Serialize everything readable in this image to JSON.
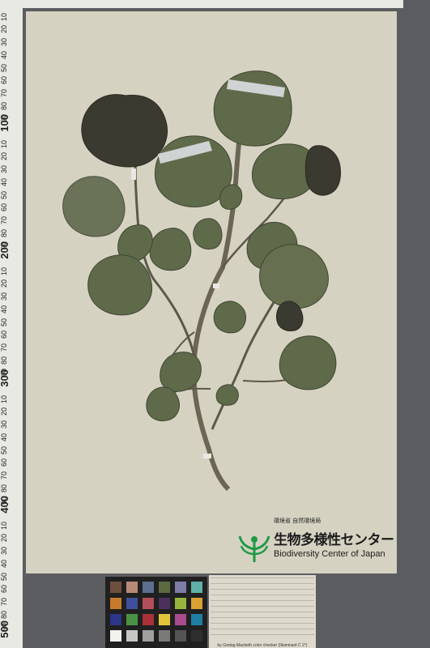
{
  "ruler": {
    "major_labels": [
      "100",
      "200",
      "300",
      "400",
      "500"
    ],
    "minor_labels": [
      "10",
      "20",
      "30",
      "40",
      "50",
      "60",
      "70",
      "80",
      "90"
    ]
  },
  "logo": {
    "ministry": "環境省 自然環境局",
    "name_jp": "生物多様性センター",
    "name_en": "Biodiversity Center of Japan"
  },
  "color_checker": {
    "caption": "by Gretag Macbeth color checker (Illuminant C 2°)"
  },
  "colors": {
    "leaf": "#5f6a4a",
    "leaf_dark": "#3b3a30",
    "stem": "#6b6654",
    "paper": "#d6d2c2",
    "label_tape": "#cfd3d3",
    "logo_green": "#1e9a45"
  }
}
